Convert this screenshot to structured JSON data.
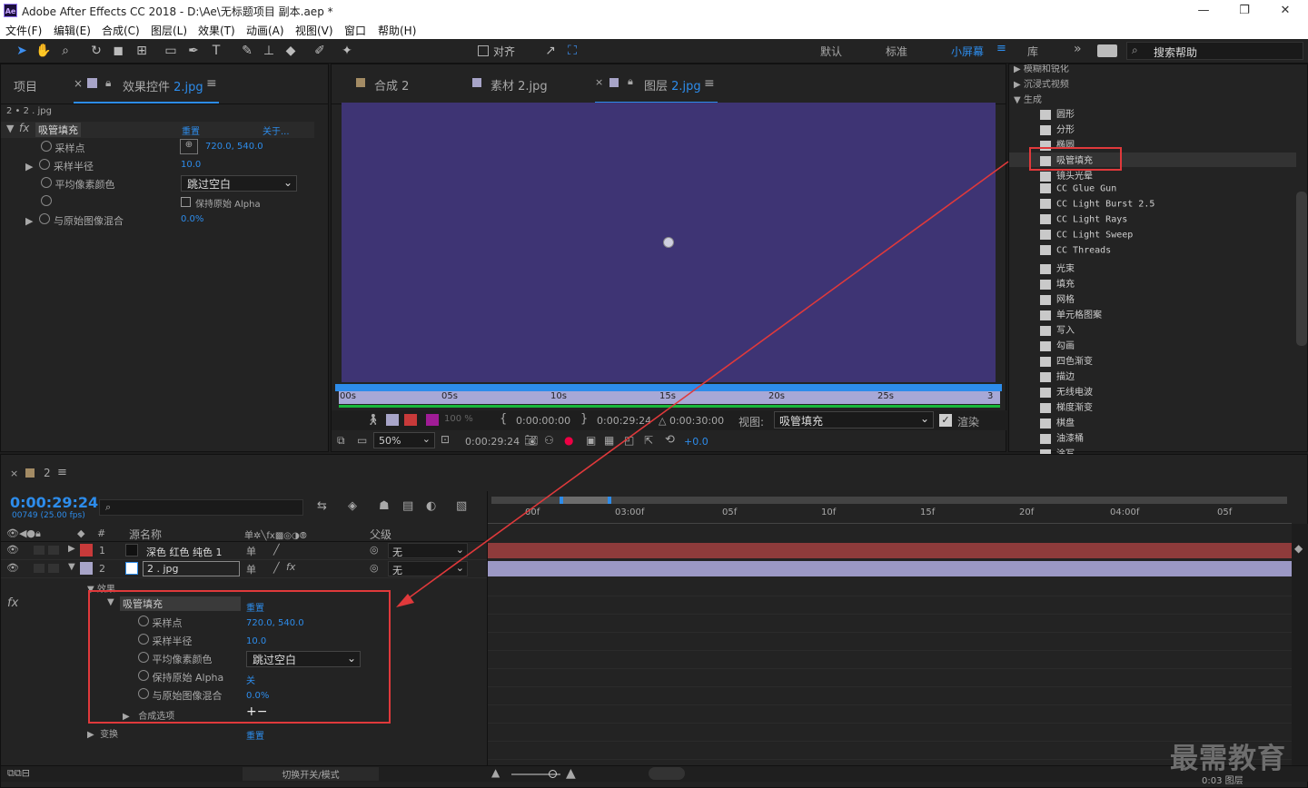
{
  "app": {
    "title": "Adobe After Effects CC 2018 - D:\\Ae\\无标题项目 副本.aep *",
    "logo": "Ae"
  },
  "menu": [
    "文件(F)",
    "编辑(E)",
    "合成(C)",
    "图层(L)",
    "效果(T)",
    "动画(A)",
    "视图(V)",
    "窗口",
    "帮助(H)"
  ],
  "toolbar": {
    "align_label": "对齐",
    "workspaces": [
      "默认",
      "标准",
      "小屏幕",
      "库"
    ],
    "search_placeholder": "搜索帮助"
  },
  "effect_controls": {
    "tab_project": "项目",
    "tab_label": "效果控件",
    "tab_target": "2.jpg",
    "breadcrumb": "2 • 2 . jpg",
    "effect_name": "吸管填充",
    "reset": "重置",
    "about": "关于...",
    "props": [
      {
        "label": "采样点",
        "value": "720.0, 540.0"
      },
      {
        "label": "采样半径",
        "value": "10.0"
      },
      {
        "label": "平均像素颜色",
        "value": "跳过空白"
      },
      {
        "label": "",
        "value": "保持原始 Alpha"
      },
      {
        "label": "与原始图像混合",
        "value": "0.0%"
      }
    ]
  },
  "viewer": {
    "tabs": [
      "合成 2",
      "素材 2.jpg",
      "图层"
    ],
    "active_tab_target": "2.jpg",
    "bg_color": "#3e3474",
    "ruler_labels": [
      "00s",
      "05s",
      "10s",
      "15s",
      "20s",
      "25s",
      "3"
    ],
    "opacity": "100 %",
    "in_time": "0:00:00:00",
    "out_time": "0:00:29:24",
    "duration": "△ 0:00:30:00",
    "view_label": "视图:",
    "view_value": "吸管填充",
    "render_label": "渲染",
    "zoom": "50%",
    "current_time": "0:00:29:24",
    "exposure": "+0.0"
  },
  "effects_panel": {
    "partial_top": "模糊和锐化",
    "immersive": "沉浸式视频",
    "category": "生成",
    "items": [
      "圆形",
      "分形",
      "椭圆",
      "吸管填充",
      "镜头光晕",
      "CC Glue Gun",
      "CC Light Burst 2.5",
      "CC Light Rays",
      "CC Light Sweep",
      "CC Threads",
      "光束",
      "填充",
      "网格",
      "单元格图案",
      "写入",
      "勾画",
      "四色渐变",
      "描边",
      "无线电波",
      "梯度渐变",
      "棋盘",
      "油漆桶",
      "涂写"
    ],
    "highlighted": "吸管填充"
  },
  "timeline": {
    "comp_name": "2",
    "timecode": "0:00:29:24",
    "frames": "00749 (25.00 fps)",
    "col_source": "源名称",
    "col_parent": "父级",
    "col_num": "#",
    "layers": [
      {
        "num": "1",
        "name": "深色 红色 纯色 1",
        "color": "#c83a3a",
        "parent": "无"
      },
      {
        "num": "2",
        "name": "2 . jpg",
        "color": "#a7a4c8",
        "parent": "无"
      }
    ],
    "effects_label": "效果",
    "effect_name": "吸管填充",
    "reset": "重置",
    "props": [
      {
        "label": "采样点",
        "value": "720.0, 540.0"
      },
      {
        "label": "采样半径",
        "value": "10.0"
      },
      {
        "label": "平均像素颜色",
        "value": "跳过空白"
      },
      {
        "label": "保持原始 Alpha",
        "value": "关"
      },
      {
        "label": "与原始图像混合",
        "value": "0.0%"
      }
    ],
    "composite_options": "合成选项",
    "composite_value": "+−",
    "transform": "变换",
    "transform_reset": "重置",
    "ruler_labels": [
      "00f",
      "03:00f",
      "05f",
      "10f",
      "15f",
      "20f",
      "04:00f",
      "05f"
    ],
    "toggle_label": "切换开关/模式",
    "bottom_partial": "0:03 图层"
  },
  "watermark": "最需教育",
  "colors": {
    "accent": "#2d8ceb",
    "highlight_box": "#e0393b",
    "layer1_bar": "#8e3b3b",
    "layer2_bar": "#9b98c4"
  }
}
